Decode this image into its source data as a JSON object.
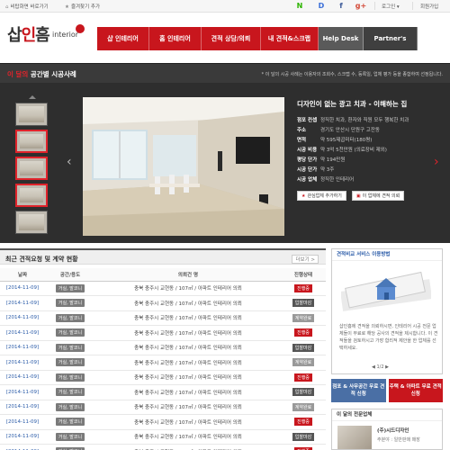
{
  "topbar": {
    "bookmark": "비탑화면 바로가기",
    "favorite": "즐겨찾기 추가",
    "login": "로그인",
    "join": "회원가입",
    "sns": [
      {
        "label": "N",
        "color": "#2db400"
      },
      {
        "label": "D",
        "color": "#3b6fd8"
      },
      {
        "label": "f",
        "color": "#3b5998"
      },
      {
        "label": "g+",
        "color": "#d34836"
      }
    ]
  },
  "logo": {
    "main_a": "삽",
    "main_b": "인",
    "main_c": "흠",
    "sub": "interior"
  },
  "gnb": [
    {
      "label": "샵 인테리어",
      "style": "red"
    },
    {
      "label": "홈 인테리어",
      "style": "red"
    },
    {
      "label": "견적 상담/의뢰",
      "style": "red"
    },
    {
      "label": "내 견적&스크랩",
      "style": "red"
    },
    {
      "label": "Help Desk",
      "style": "dark"
    },
    {
      "label": "Partner's Room",
      "style": "darker"
    }
  ],
  "case": {
    "title_a": "이 달의",
    "title_b": " 공간별 시공사례",
    "note": "* 이 달의 시공 사례는 이용자의 조회수, 스크랩 수, 등록일, 업체 평가 등을 종합하여 선정됩니다.",
    "headline": "디자인이 없는 광고 치과 - 이해하는 집",
    "fields": [
      {
        "k": "점포 컨셉",
        "v": "정직한 치과, 환자와 직원 모두 행복한 치과"
      },
      {
        "k": "주소",
        "v": "경기도 안산시 단원구 고잔동"
      },
      {
        "k": "면적",
        "v": "약 595제곱미터(180평)"
      },
      {
        "k": "시공 비용",
        "v": "약 3억 5천만원 (의료장비 제외)"
      },
      {
        "k": "평당 단가",
        "v": "약 194만원"
      },
      {
        "k": "시공 단가",
        "v": "약 3주"
      },
      {
        "k": "시공 업체",
        "v": "정직한 인테리어"
      }
    ],
    "btn_interest": "관심업체 추가하기",
    "btn_request": "이 업체에 견적 의뢰"
  },
  "list": {
    "title": "최근 견적요청 및 계약 현황",
    "more": "더보기 >",
    "columns": [
      "날짜",
      "공간/용도",
      "의뢰건 명",
      "진행상태"
    ],
    "rows": [
      {
        "date": "[2014-11-09]",
        "type": "거실, 발코니",
        "name": "충북 충주시 교현동 / 107㎡ / 아파트 인테리어 의뢰",
        "status": "진행중",
        "color": "#c8161d"
      },
      {
        "date": "[2014-11-09]",
        "type": "거실, 발코니",
        "name": "충북 충주시 교현동 / 107㎡ / 아파트 인테리어 의뢰",
        "status": "입찰마감",
        "color": "#555555"
      },
      {
        "date": "[2014-11-09]",
        "type": "거실, 발코니",
        "name": "충북 충주시 교현동 / 107㎡ / 아파트 인테리어 의뢰",
        "status": "계약완료",
        "color": "#999999"
      },
      {
        "date": "[2014-11-09]",
        "type": "거실, 발코니",
        "name": "충북 충주시 교현동 / 107㎡ / 아파트 인테리어 의뢰",
        "status": "진행중",
        "color": "#c8161d"
      },
      {
        "date": "[2014-11-09]",
        "type": "거실, 발코니",
        "name": "충북 충주시 교현동 / 107㎡ / 아파트 인테리어 의뢰",
        "status": "입찰마감",
        "color": "#555555"
      },
      {
        "date": "[2014-11-09]",
        "type": "거실, 발코니",
        "name": "충북 충주시 교현동 / 107㎡ / 아파트 인테리어 의뢰",
        "status": "계약완료",
        "color": "#999999"
      },
      {
        "date": "[2014-11-09]",
        "type": "거실, 발코니",
        "name": "충북 충주시 교현동 / 107㎡ / 아파트 인테리어 의뢰",
        "status": "진행중",
        "color": "#c8161d"
      },
      {
        "date": "[2014-11-09]",
        "type": "거실, 발코니",
        "name": "충북 충주시 교현동 / 107㎡ / 아파트 인테리어 의뢰",
        "status": "입찰마감",
        "color": "#555555"
      },
      {
        "date": "[2014-11-09]",
        "type": "거실, 발코니",
        "name": "충북 충주시 교현동 / 107㎡ / 아파트 인테리어 의뢰",
        "status": "계약완료",
        "color": "#999999"
      },
      {
        "date": "[2014-11-09]",
        "type": "거실, 발코니",
        "name": "충북 충주시 교현동 / 107㎡ / 아파트 인테리어 의뢰",
        "status": "진행중",
        "color": "#c8161d"
      },
      {
        "date": "[2014-11-09]",
        "type": "거실, 발코니",
        "name": "충북 충주시 교현동 / 107㎡ / 아파트 인테리어 의뢰",
        "status": "입찰마감",
        "color": "#555555"
      },
      {
        "date": "[2014-11-09]",
        "type": "거실, 발코니",
        "name": "충북 충주시 교현동 / 107㎡ / 아파트 인테리어 의뢰",
        "status": "진행중",
        "color": "#c8161d"
      }
    ]
  },
  "side": {
    "box1_title": "견적비교 서비스 이용방법",
    "box1_text": "샵인흠에 견적을 의뢰하시면, 인테리어 시공 전문 업체들이 무료로 해당 공사의 견적을 제시합니다. 이 견적들을 검토하시고 가장 합리적 제안을 한 업체를 선택하세요.",
    "pager": "1/2",
    "btn_a": "점포 & 사무공간 무료 견적 신청",
    "btn_b": "주택 & 아파트 무료 견적 신청",
    "box2_title": "이 달의 전문업체",
    "box2_name": "(주)시드디자인",
    "box2_desc": "주분야 : 일반판매 매장"
  }
}
